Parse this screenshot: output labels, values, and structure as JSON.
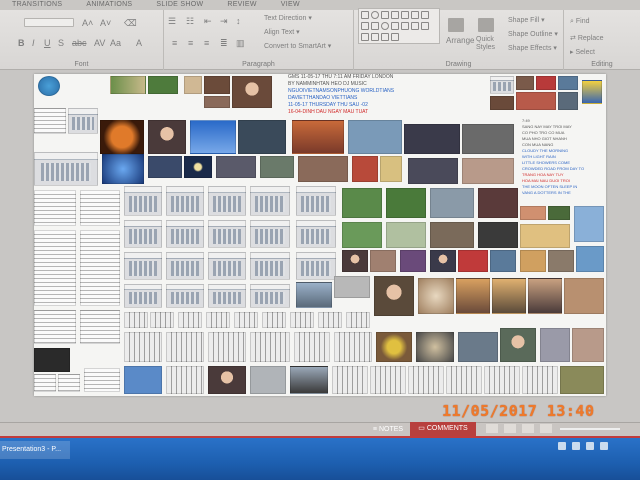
{
  "ribbon_tabs": [
    "TRANSITIONS",
    "ANIMATIONS",
    "SLIDE SHOW",
    "REVIEW",
    "VIEW"
  ],
  "ribbon": {
    "font_group_label": "Font",
    "paragraph_group_label": "Paragraph",
    "drawing_group_label": "Drawing",
    "editing_group_label": "Editing",
    "text_direction": "Text Direction",
    "align_text": "Align Text",
    "convert_smartart": "Convert to SmartArt",
    "arrange": "Arrange",
    "quick_styles": "Quick Styles",
    "shape_fill": "Shape Fill",
    "shape_outline": "Shape Outline",
    "shape_effects": "Shape Effects",
    "find": "Find",
    "replace": "Replace",
    "select": "Select"
  },
  "slide": {
    "header_lines": [
      "GMS 11-05-17 THU 7:11 AM FRIDAY LONDON",
      "BY NAMMINHTAN HEO DJ MUSIC",
      "NGUOIVIETNAMSONPHUONG WORLDTIANS",
      "DAVIETTHANDAO VIETTIANS",
      "11-05-17 THURSDAY  THU SAU -02",
      "16-04-DINH DAU NGAY MAU TUAT"
    ],
    "header_colors": [
      "#555555",
      "#555555",
      "#2a63c4",
      "#2a63c4",
      "#2a63c4",
      "#d12a2a"
    ],
    "right_lines": [
      "7:49",
      "SANG NAY MAY TROI MAY",
      "CO PHO TRO CO MUA",
      "MUA NHO GIOT NHANH",
      "CON MUA NANG",
      "",
      "CLOUDY THE MORNING",
      "WITH LIGHT RAIN",
      "LITTLE SHOWERS COME",
      "CROWDED ROAD FROM DAY TO",
      "",
      "TRANG HOA NAY TUY",
      "HOA MAI NAU DUOI TROI",
      "THE MOON OFTEN SLEEP IN",
      "VANG A DOTTERS IN THE"
    ],
    "right_colors": [
      "#555555",
      "#555555",
      "#555555",
      "#555555",
      "#555555",
      "#555555",
      "#2a63c4",
      "#2a63c4",
      "#2a63c4",
      "#2a63c4",
      "#555555",
      "#d12a2a",
      "#d12a2a",
      "#2a63c4",
      "#2a63c4"
    ]
  },
  "statusbar": {
    "notes_label": "NOTES",
    "comments_label": "COMMENTS",
    "accent_color": "#b8403e"
  },
  "taskbar": {
    "app_label": "Presentation3 - P..."
  },
  "photo_timestamp": "11/05/2017  13:40"
}
